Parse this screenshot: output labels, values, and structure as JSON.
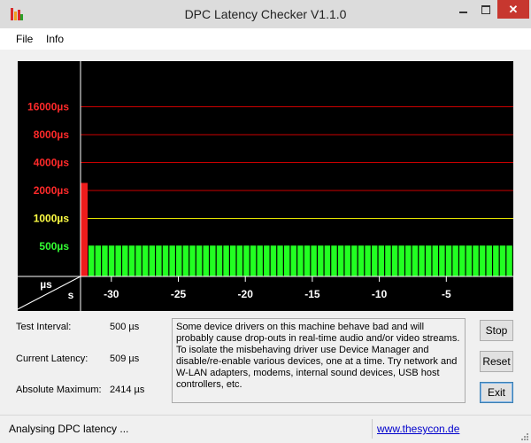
{
  "window": {
    "title": "DPC Latency Checker V1.1.0"
  },
  "icons": {
    "app": "bar-chart-app-icon",
    "minimize": "minimize-icon",
    "maximize": "maximize-icon",
    "close": "close-icon"
  },
  "menu": {
    "file": "File",
    "info": "Info"
  },
  "chart_data": {
    "type": "bar",
    "ylabel": "µs",
    "xlabel": "s",
    "y_ticks": [
      {
        "label": "16000µs",
        "value": 16000,
        "color": "#ff2a2a"
      },
      {
        "label": "8000µs",
        "value": 8000,
        "color": "#ff2a2a"
      },
      {
        "label": "4000µs",
        "value": 4000,
        "color": "#ff2a2a"
      },
      {
        "label": "2000µs",
        "value": 2000,
        "color": "#ff2a2a"
      },
      {
        "label": "1000µs",
        "value": 1000,
        "color": "#ffff44"
      },
      {
        "label": "500µs",
        "value": 500,
        "color": "#33ff33"
      }
    ],
    "x_ticks": [
      {
        "label": "-30",
        "value": -30
      },
      {
        "label": "-25",
        "value": -25
      },
      {
        "label": "-20",
        "value": -20
      },
      {
        "label": "-15",
        "value": -15
      },
      {
        "label": "-10",
        "value": -10
      },
      {
        "label": "-5",
        "value": -5
      }
    ],
    "x_range": [
      -32.3,
      0
    ],
    "values": [
      2414,
      509,
      509,
      509,
      509,
      509,
      509,
      509,
      509,
      509,
      509,
      509,
      509,
      509,
      509,
      509,
      509,
      509,
      509,
      509,
      509,
      509,
      509,
      509,
      509,
      509,
      509,
      509,
      509,
      509,
      509,
      509,
      509,
      509,
      509,
      509,
      509,
      509,
      509,
      509,
      509,
      509,
      509,
      509,
      509,
      509,
      509,
      509,
      509,
      509,
      509,
      509,
      509,
      509,
      509,
      509,
      509,
      509,
      509,
      509,
      509,
      509,
      509,
      509
    ],
    "colors": {
      "background": "#000000",
      "gridline_red": "#cc0000",
      "gridline_yellow": "#e8e800",
      "bar_red": "#ee1c1c",
      "bar_green": "#22ff22",
      "axis": "#ffffff"
    }
  },
  "stats": {
    "test_interval_label": "Test Interval:",
    "test_interval_value": "500 µs",
    "current_latency_label": "Current Latency:",
    "current_latency_value": "509 µs",
    "absolute_maximum_label": "Absolute Maximum:",
    "absolute_maximum_value": "2414 µs"
  },
  "message": "Some device drivers on this machine behave bad and will probably cause drop-outs in real-time audio and/or video streams. To isolate the misbehaving driver use Device Manager and disable/re-enable various devices, one at a time. Try network and W-LAN adapters, modems, internal sound devices, USB host controllers, etc.",
  "buttons": {
    "stop": "Stop",
    "reset": "Reset",
    "exit": "Exit"
  },
  "status": {
    "text": "Analysing DPC latency ...",
    "link": "www.thesycon.de"
  }
}
